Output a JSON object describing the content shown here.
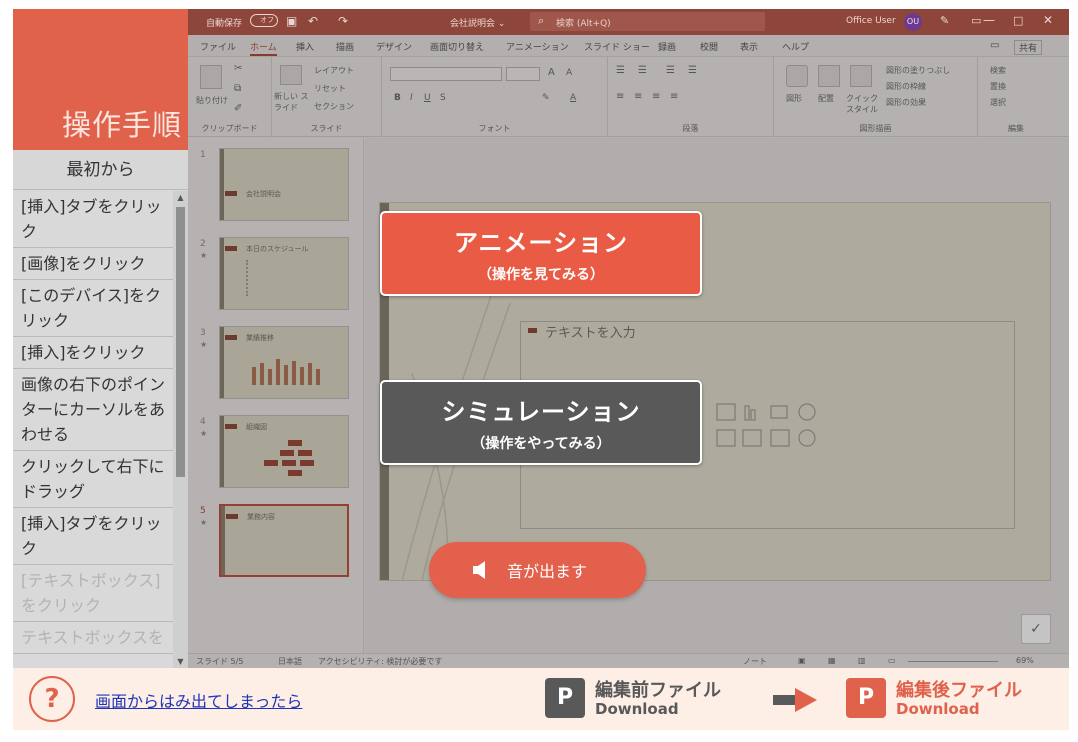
{
  "sidebar": {
    "title": "操作手順",
    "start_label": "最初から",
    "steps": [
      "[挿入]タブをクリック",
      "[画像]をクリック",
      "[このデバイス]をクリック",
      "[挿入]をクリック",
      "画像の右下のポインターにカーソルをあわせる",
      "クリックして右下にドラッグ",
      "[挿入]タブをクリック",
      "[テキストボックス]をクリック",
      "テキストボックスを"
    ]
  },
  "ppt": {
    "titlebar": {
      "autosave": "自動保存",
      "autosave_state": "オフ",
      "doc_name": "会社説明会 ⌄",
      "search_placeholder": "検索 (Alt+Q)",
      "user_name": "Office User",
      "user_initials": "OU"
    },
    "tabs": [
      "ファイル",
      "ホーム",
      "挿入",
      "描画",
      "デザイン",
      "画面切り替え",
      "アニメーション",
      "スライド ショー",
      "録画",
      "校閲",
      "表示",
      "ヘルプ"
    ],
    "active_tab": "ホーム",
    "share_label": "共有",
    "ribbon": {
      "groups": [
        "クリップボード",
        "スライド",
        "フォント",
        "段落",
        "図形描画",
        "編集"
      ],
      "paste": "貼り付け",
      "new_slide": "新しい スライド",
      "layout": "レイアウト",
      "reset": "リセット",
      "section": "セクション",
      "shapes": "図形",
      "arrange": "配置",
      "quick_style": "クイック スタイル",
      "shape_fill": "図形の塗りつぶし",
      "shape_outline": "図形の枠線",
      "shape_effects": "図形の効果",
      "find": "検索",
      "replace": "置換",
      "select": "選択"
    },
    "thumbnails": [
      {
        "num": "1",
        "star": "",
        "title": "会社説明会"
      },
      {
        "num": "2",
        "star": "★",
        "title": "本日のスケジュール"
      },
      {
        "num": "3",
        "star": "★",
        "title": "業績推移"
      },
      {
        "num": "4",
        "star": "★",
        "title": "組織図"
      },
      {
        "num": "5",
        "star": "★",
        "title": "業務内容"
      }
    ],
    "slide": {
      "placeholder_text": "テキストを入力"
    },
    "status": {
      "slide_info": "スライド 5/5",
      "language": "日本語",
      "accessibility": "アクセシビリティ: 検討が必要です",
      "notes": "ノート",
      "zoom": "69%"
    }
  },
  "overlay": {
    "animation_main": "アニメーション",
    "animation_sub": "（操作を見てみる）",
    "simulation_main": "シミュレーション",
    "simulation_sub": "（操作をやってみる）",
    "sound_label": "音が出ます"
  },
  "footer": {
    "help_icon": "?",
    "help_link": "画面からはみ出てしまったら",
    "before_title": "編集前ファイル",
    "before_sub": "Download",
    "after_title": "編集後ファイル",
    "after_sub": "Download",
    "file_icon_letter": "P"
  },
  "colors": {
    "accent": "#e0624b",
    "dark": "#595959",
    "footer_bg": "#fdeee6",
    "link": "#2134b8"
  }
}
